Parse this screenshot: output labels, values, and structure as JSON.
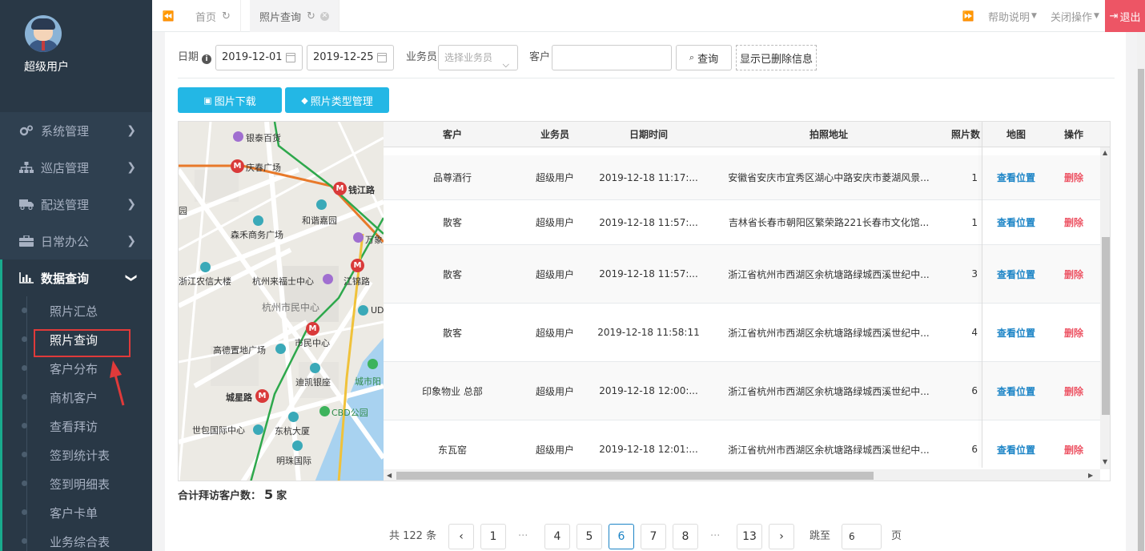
{
  "user": {
    "name": "超级用户"
  },
  "sidebar": {
    "items": [
      {
        "label": "系统管理",
        "icon": "gears-icon"
      },
      {
        "label": "巡店管理",
        "icon": "sitemap-icon"
      },
      {
        "label": "配送管理",
        "icon": "truck-icon"
      },
      {
        "label": "日常办公",
        "icon": "briefcase-icon"
      },
      {
        "label": "数据查询",
        "icon": "bar-chart-icon"
      }
    ],
    "sub_items": [
      "照片汇总",
      "照片查询",
      "客户分布",
      "商机客户",
      "查看拜访",
      "签到统计表",
      "签到明细表",
      "客户卡单",
      "业务综合表"
    ]
  },
  "tabs": [
    {
      "label": "首页"
    },
    {
      "label": "照片查询"
    }
  ],
  "topbar": {
    "help": "帮助说明",
    "close_ops": "关闭操作",
    "logout": "退出"
  },
  "filters": {
    "date_label": "日期",
    "start_date": "2019-12-01",
    "end_date": "2019-12-25",
    "salesman_label": "业务员",
    "salesman_placeholder": "选择业务员",
    "customer_label": "客户",
    "customer_value": "",
    "search_button": "查询",
    "show_deleted_button": "显示已删除信息"
  },
  "actions": {
    "download": "图片下载",
    "type_manage": "照片类型管理"
  },
  "map": {
    "labels": {
      "yintai": "银泰百货",
      "qingchun": "庆春广场",
      "qianjiang": "钱江路",
      "hexie": "和谐嘉园",
      "senhe": "森禾商务广场",
      "wanxiang": "万象",
      "nongxin": "浙江农信大楼",
      "laifushi": "杭州来福士中心",
      "jiangjin": "江锦路",
      "shiminzhongxin": "杭州市民中心",
      "ud": "UD",
      "gaode": "高德置地广场",
      "shimin_metro": "市民中心",
      "dikai": "迪凯银座",
      "chengshiyang": "城市阳",
      "chengxing": "城星路",
      "cbd": "CBD公园",
      "shibao": "世包国际中心",
      "donghang": "东杭大厦",
      "mingzhu": "明珠国际",
      "zhao": "园"
    }
  },
  "table": {
    "headers": [
      "客户",
      "业务员",
      "日期时间",
      "拍照地址",
      "照片数",
      "地图",
      "操作"
    ],
    "rows": [
      {
        "customer": "品尊酒行",
        "salesman": "超级用户",
        "datetime": "2019-12-18 11:17:...",
        "address": "安徽省安庆市宜秀区湖心中路安庆市菱湖风景...",
        "count": "1",
        "map": "查看位置",
        "op": "删除"
      },
      {
        "customer": "散客",
        "salesman": "超级用户",
        "datetime": "2019-12-18 11:57:...",
        "address": "吉林省长春市朝阳区繁荣路221长春市文化馆...",
        "count": "1",
        "map": "查看位置",
        "op": "删除"
      },
      {
        "customer": "散客",
        "salesman": "超级用户",
        "datetime": "2019-12-18 11:57:...",
        "address": "浙江省杭州市西湖区余杭塘路绿城西溪世纪中...",
        "count": "3",
        "map": "查看位置",
        "op": "删除"
      },
      {
        "customer": "散客",
        "salesman": "超级用户",
        "datetime": "2019-12-18 11:58:11",
        "address": "浙江省杭州市西湖区余杭塘路绿城西溪世纪中...",
        "count": "4",
        "map": "查看位置",
        "op": "删除"
      },
      {
        "customer": "印象物业 总部",
        "salesman": "超级用户",
        "datetime": "2019-12-18 12:00:...",
        "address": "浙江省杭州市西湖区余杭塘路绿城西溪世纪中...",
        "count": "6",
        "map": "查看位置",
        "op": "删除"
      },
      {
        "customer": "东瓦窑",
        "salesman": "超级用户",
        "datetime": "2019-12-18 12:01:...",
        "address": "浙江省杭州市西湖区余杭塘路绿城西溪世纪中...",
        "count": "6",
        "map": "查看位置",
        "op": "删除"
      }
    ]
  },
  "summary": {
    "prefix": "合计拜访客户数：",
    "count": "5",
    "suffix": "家"
  },
  "pagination": {
    "total_text": "共 122 条",
    "pages": [
      "1",
      "4",
      "5",
      "6",
      "7",
      "8",
      "13"
    ],
    "current": "6",
    "dots": "···",
    "jump_label": "跳至",
    "jump_value": "6",
    "page_suffix": "页"
  },
  "colors": {
    "sidebar_bg": "#2f4050",
    "accent_blue": "#23b7e5",
    "link": "#1c84c6",
    "danger": "#ed5565"
  }
}
